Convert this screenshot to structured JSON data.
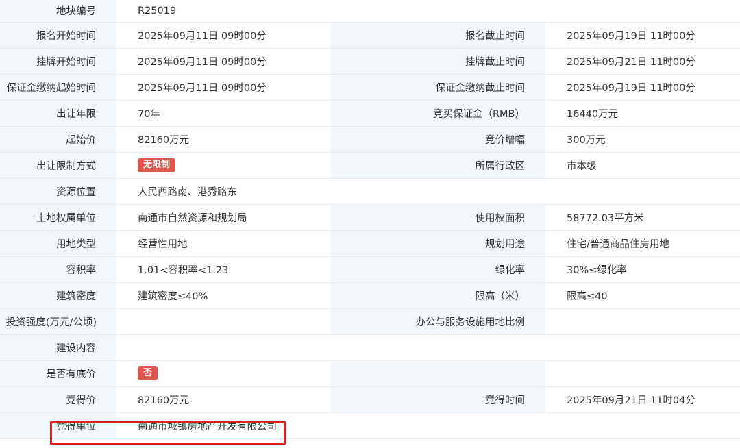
{
  "rows": [
    {
      "l1": "地块编号",
      "v1": "R25019"
    },
    {
      "l1": "报名开始时间",
      "v1": "2025年09月11日 09时00分",
      "l2": "报名截止时间",
      "v2": "2025年09月19日 11时00分"
    },
    {
      "l1": "挂牌开始时间",
      "v1": "2025年09月11日 09时00分",
      "l2": "挂牌截止时间",
      "v2": "2025年09月21日 11时00分"
    },
    {
      "l1": "保证金缴纳起始时间",
      "v1": "2025年09月11日 09时00分",
      "l2": "保证金缴纳截止时间",
      "v2": "2025年09月19日 11时00分"
    },
    {
      "l1": "出让年限",
      "v1": "70年",
      "l2": "竞买保证金（RMB）",
      "v2": "16440万元"
    },
    {
      "l1": "起始价",
      "v1": "82160万元",
      "l2": "竞价增幅",
      "v2": "300万元"
    },
    {
      "l1": "出让限制方式",
      "v1_tag": "无限制",
      "l2": "所属行政区",
      "v2": "市本级"
    },
    {
      "l1": "资源位置",
      "v1": "人民西路南、港秀路东"
    },
    {
      "l1": "土地权属单位",
      "v1": "南通市自然资源和规划局",
      "l2": "使用权面积",
      "v2": "58772.03平方米"
    },
    {
      "l1": "用地类型",
      "v1": "经营性用地",
      "l2": "规划用途",
      "v2": "住宅/普通商品住房用地"
    },
    {
      "l1": "容积率",
      "v1": "1.01<容积率<1.23",
      "l2": "绿化率",
      "v2": "30%≤绿化率"
    },
    {
      "l1": "建筑密度",
      "v1": "建筑密度≤40%",
      "l2": "限高（米）",
      "v2": "限高≤40"
    },
    {
      "l1": "投资强度(万元/公顷)",
      "v1": "",
      "l2": "办公与服务设施用地比例",
      "v2": ""
    },
    {
      "l1": "建设内容",
      "v1": ""
    },
    {
      "l1": "是否有底价",
      "v1_tag": "否",
      "l2": "",
      "v2": ""
    },
    {
      "l1": "竞得价",
      "v1": "82160万元",
      "l2": "竞得时间",
      "v2": "2025年09月21日 11时04分"
    },
    {
      "l1": "竞得单位",
      "v1": "南通市城镇房地产开发有限公司",
      "l2": "",
      "v2": ""
    }
  ],
  "colors": {
    "label_bg": "#f2f7fc",
    "tag_bg": "#e0544b",
    "highlight": "#e02020"
  }
}
